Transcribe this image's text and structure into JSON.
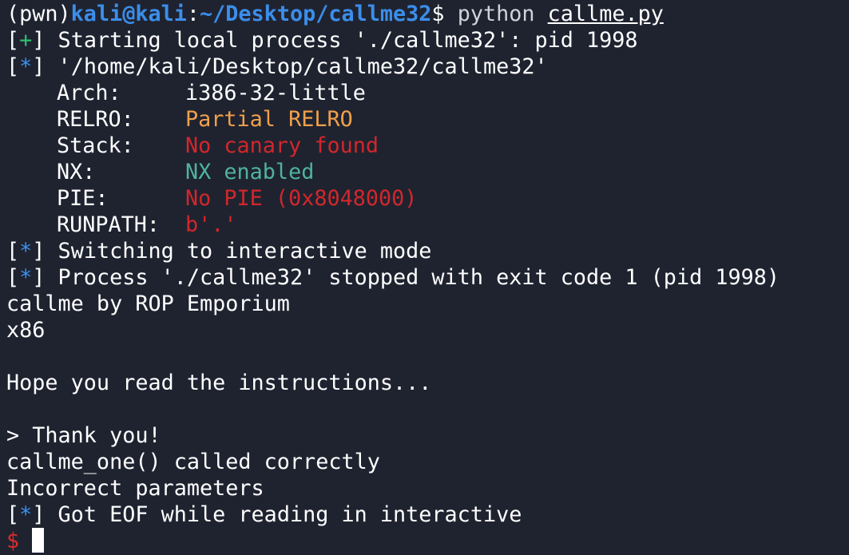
{
  "prompt": {
    "env": "(pwn)",
    "user_host": "kali@kali",
    "colon": ":",
    "path": "~/Desktop/callme32",
    "dollar": "$",
    "command": "python",
    "argument": "callme.py"
  },
  "lines": {
    "start_bracket_open": "[",
    "start_marker": "+",
    "start_bracket_close": "]",
    "start_text": " Starting local process './callme32': pid 1998",
    "binpath_text": " '/home/kali/Desktop/callme32/callme32'",
    "info_marker": "*",
    "switching_text": " Switching to interactive mode",
    "stopped_text": " Process './callme32' stopped with exit code 1 (pid 1998)",
    "banner": "callme by ROP Emporium",
    "arch_line": "x86",
    "blank1": "",
    "hope": "Hope you read the instructions...",
    "blank2": "",
    "thank": "> Thank you!",
    "callme_one": "callme_one() called correctly",
    "incorrect": "Incorrect parameters",
    "eof_text": " Got EOF while reading in interactive",
    "final_prompt": "$"
  },
  "checksec": [
    {
      "key": "Arch:",
      "value": "i386-32-little",
      "color": "#ffffff"
    },
    {
      "key": "RELRO:",
      "value": "Partial RELRO",
      "color": "#f0a04b"
    },
    {
      "key": "Stack:",
      "value": "No canary found",
      "color": "#d2272b"
    },
    {
      "key": "NX:",
      "value": "NX enabled",
      "color": "#4fb3a0"
    },
    {
      "key": "PIE:",
      "value": "No PIE (0x8048000)",
      "color": "#d2272b"
    },
    {
      "key": "RUNPATH:",
      "value": "b'.'",
      "color": "#d2272b"
    }
  ]
}
